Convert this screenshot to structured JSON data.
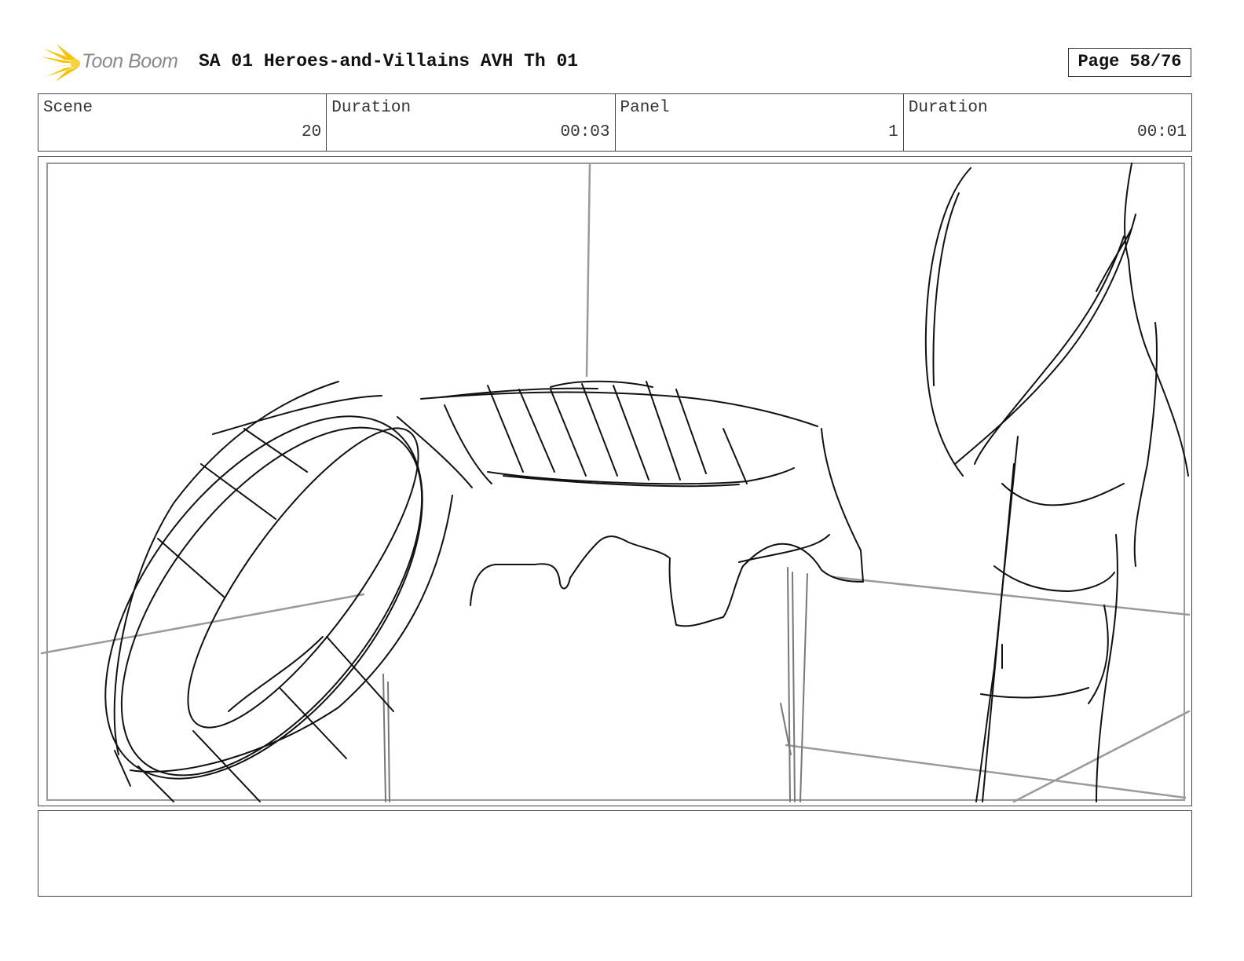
{
  "header": {
    "logo_text": "Toon Boom",
    "title": "SA 01 Heroes-and-Villains AVH Th 01",
    "page": "Page 58/76",
    "logo_color": "#f5c300"
  },
  "info": {
    "scene_label": "Scene",
    "scene_value": "20",
    "scene_duration_label": "Duration",
    "scene_duration_value": "00:03",
    "panel_label": "Panel",
    "panel_value": "1",
    "panel_duration_label": "Duration",
    "panel_duration_value": "00:01"
  },
  "notes": {
    "dialogue": "",
    "action": ""
  }
}
